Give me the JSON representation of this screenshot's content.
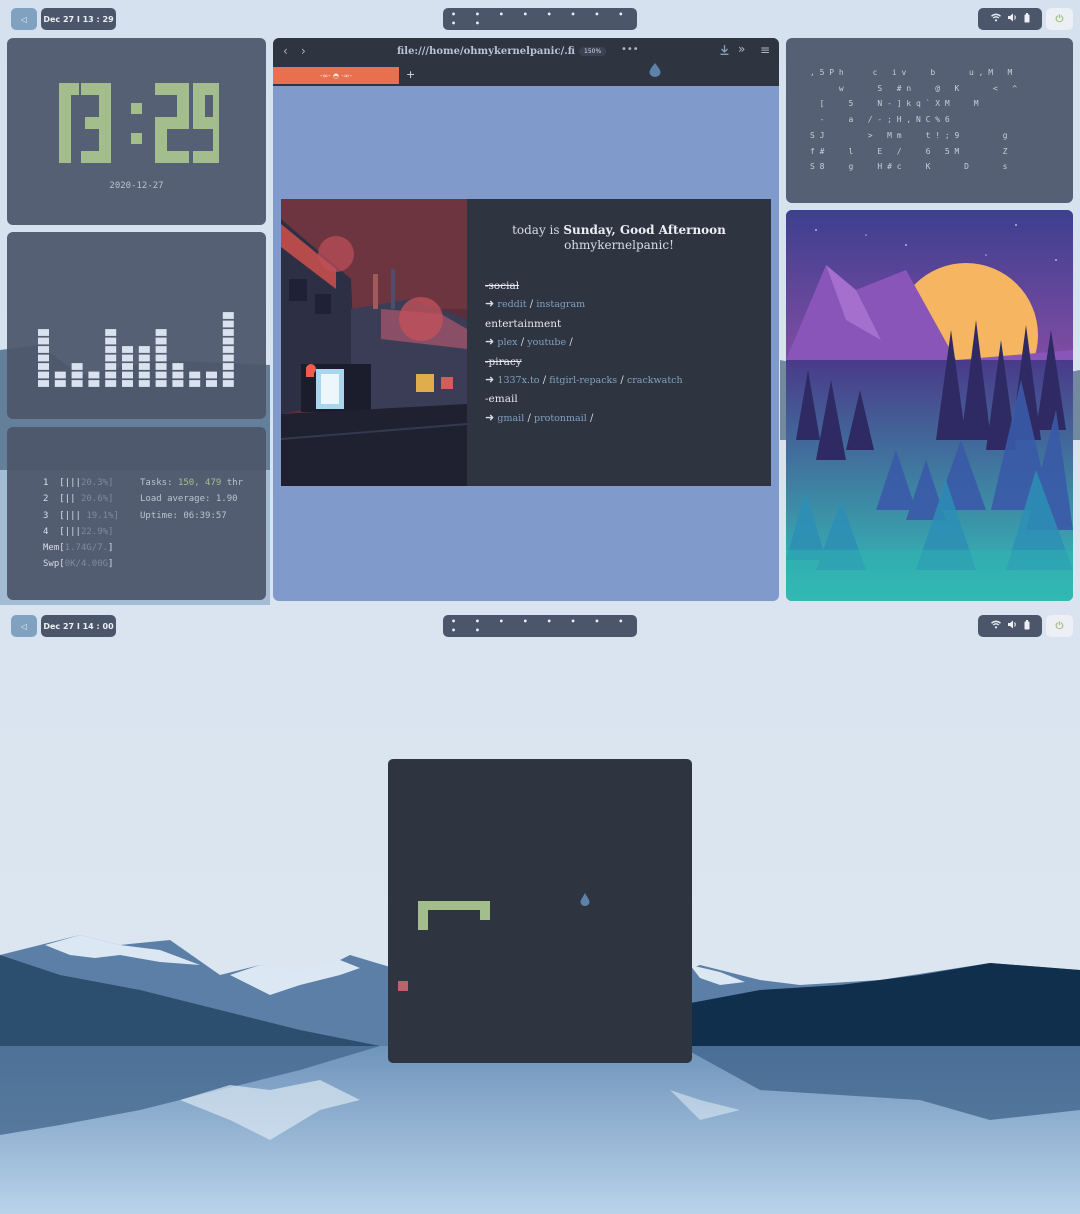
{
  "colors": {
    "accent": "#81a1c1",
    "green": "#a3be8c",
    "panel": "#4c566a",
    "dark": "#2e3440",
    "tab": "#e8704f",
    "snake_food": "#bf616a"
  },
  "screens": [
    {
      "topbar": {
        "launcher_icon": "launcher-icon",
        "date_time": "Dec 27 Ι 13 : 29",
        "workspaces": "• • • • • • • • • •",
        "tray_icons": [
          "wifi-icon",
          "volume-icon",
          "battery-icon"
        ],
        "power_icon": "power-icon"
      }
    },
    {
      "topbar": {
        "launcher_icon": "launcher-icon",
        "date_time": "Dec 27 Ι 14 : 00",
        "workspaces": "• • • • • • • • • •",
        "tray_icons": [
          "wifi-icon",
          "volume-icon",
          "battery-icon"
        ],
        "power_icon": "power-icon"
      }
    }
  ],
  "clock": {
    "time": "13:29",
    "date": "2020-12-27"
  },
  "visualizer": {
    "levels": [
      6,
      1,
      2,
      1,
      6,
      4,
      4,
      6,
      2,
      1,
      1,
      8
    ]
  },
  "htop": {
    "cpus": [
      {
        "n": "1",
        "bar": "[|||",
        "pct": "20.3%]"
      },
      {
        "n": "2",
        "bar": "[||",
        "pct": " 20.6%]"
      },
      {
        "n": "3",
        "bar": "[|||",
        "pct": " 19.1%]"
      },
      {
        "n": "4",
        "bar": "[|||",
        "pct": "22.9%]"
      }
    ],
    "mem": {
      "label": "Mem[",
      "value": "1.74G/7.",
      "end": "]"
    },
    "swp": {
      "label": "Swp[",
      "value": "0K/4.00G",
      "end": "]"
    },
    "tasks_label": "Tasks:",
    "tasks_value": "150,",
    "threads_value": "479",
    "threads_label": "thr",
    "load_label": "Load average:",
    "load_value": "1.90",
    "uptime_label": "Uptime:",
    "uptime_value": "06:39:57"
  },
  "browser": {
    "url": "file:///home/ohmykernelpanic/.firef",
    "zoom": "150%",
    "tab_title": "-∞- ◓ -∞-",
    "new_tab": "+",
    "icons": [
      "back-icon",
      "forward-icon",
      "more-icon",
      "download-icon",
      "overflow-icon",
      "menu-icon"
    ],
    "greeting_prefix": "today is",
    "greeting_day": "Sunday, Good Afternoon",
    "greeting_user": "ohmykernelpanic!",
    "arrow": "➜",
    "categories": [
      {
        "title": "-social",
        "struck": true,
        "links": [
          "reddit",
          "instagram"
        ]
      },
      {
        "title": " entertainment",
        "struck": false,
        "links": [
          "plex",
          "youtube"
        ]
      },
      {
        "title": "-piracy",
        "struck": true,
        "links": [
          "1337x.to",
          "fitgirl-repacks",
          "crackwatch"
        ]
      },
      {
        "title": "-email",
        "struck": false,
        "links": [
          "gmail",
          "protonmail"
        ]
      }
    ]
  },
  "matrix": {
    "rows": [
      ", 5 P h      c   i v     b       u , M   M",
      "      w       S   # n     @   K       <   ^",
      "  [     5     N - ] k q ` X M     M",
      "  -     a   / - ; H , N C % 6",
      "S J         >   M m     t ! ; 9         g",
      "f #     l     E   /     6   5 M         Z",
      "S 8     g     H # c     K       D       s"
    ]
  },
  "snake": {
    "game": "snake",
    "food": "food-block"
  }
}
